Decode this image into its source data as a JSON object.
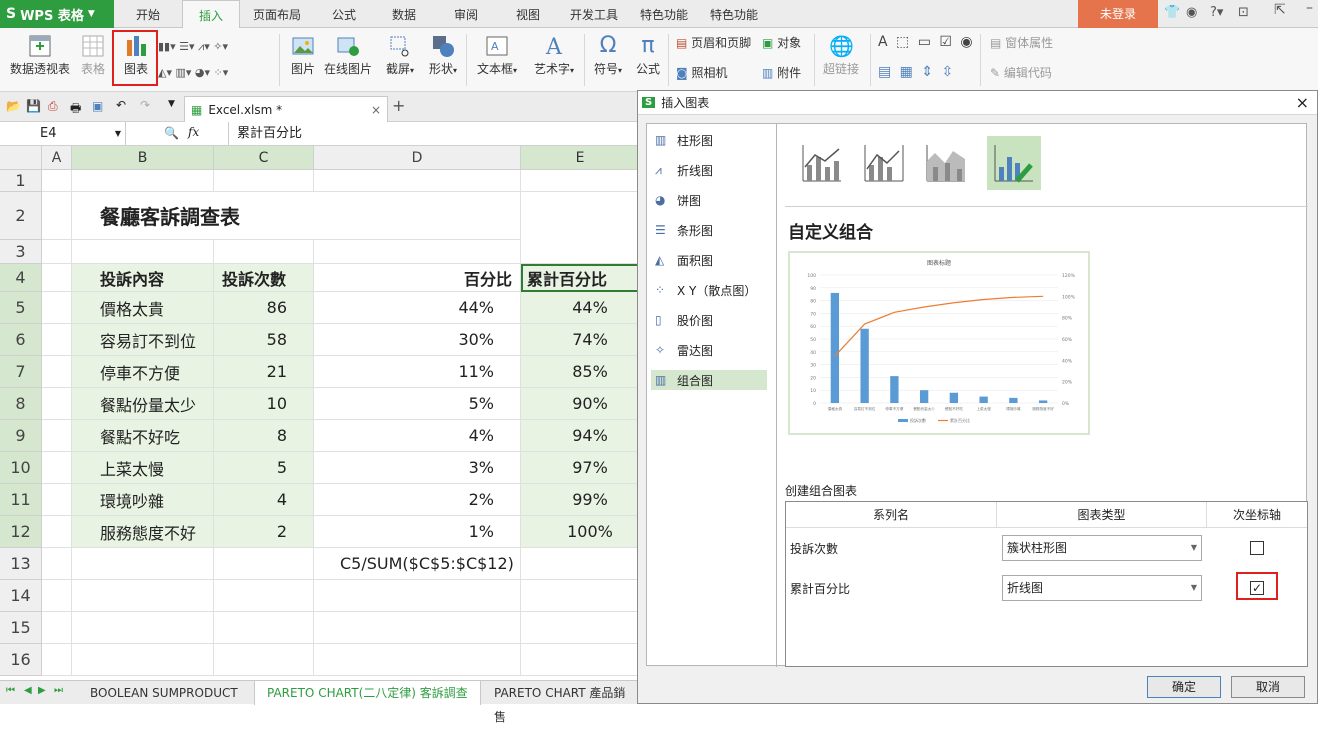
{
  "app": {
    "title": "WPS 表格",
    "login": "未登录"
  },
  "tabs": [
    "开始",
    "插入",
    "页面布局",
    "公式",
    "数据",
    "审阅",
    "视图",
    "开发工具",
    "特色功能",
    "特色功能"
  ],
  "active_tab": "插入",
  "ribbon": {
    "pivot": "数据透视表",
    "table": "表格",
    "chart": "图表",
    "picture": "图片",
    "online_picture": "在线图片",
    "screenshot": "截屏",
    "shape": "形状",
    "textbox": "文本框",
    "wordart": "艺术字",
    "symbol": "符号",
    "formula": "公式",
    "header_footer": "页眉和页脚",
    "object": "对象",
    "camera": "照相机",
    "attachment": "附件",
    "hyperlink": "超链接",
    "form_props": "窗体属性",
    "edit_code": "编辑代码"
  },
  "doc": {
    "tab": "Excel.xlsm *"
  },
  "formula_bar": {
    "cell_ref": "E4",
    "fx": "fx",
    "value": "累計百分比"
  },
  "grid": {
    "columns": [
      "A",
      "B",
      "C",
      "D",
      "E"
    ],
    "rows": [
      "1",
      "2",
      "3",
      "4",
      "5",
      "6",
      "7",
      "8",
      "9",
      "10",
      "11",
      "12",
      "13",
      "14",
      "15",
      "16"
    ],
    "title": "餐廳客訴調查表",
    "headers": [
      "投訴內容",
      "投訴次數",
      "百分比",
      "累計百分比"
    ],
    "data": [
      [
        "價格太貴",
        "86",
        "44%",
        "44%"
      ],
      [
        "容易訂不到位",
        "58",
        "30%",
        "74%"
      ],
      [
        "停車不方便",
        "21",
        "11%",
        "85%"
      ],
      [
        "餐點份量太少",
        "10",
        "5%",
        "90%"
      ],
      [
        "餐點不好吃",
        "8",
        "4%",
        "94%"
      ],
      [
        "上菜太慢",
        "5",
        "3%",
        "97%"
      ],
      [
        "環境吵雜",
        "4",
        "2%",
        "99%"
      ],
      [
        "服務態度不好",
        "2",
        "1%",
        "100%"
      ]
    ],
    "formula_note": "C5/SUM($C$5:$C$12)"
  },
  "sheets": [
    "BOOLEAN SUMPRODUCT",
    "PARETO CHART(二八定律) 客訴調查",
    "PARETO CHART 產品銷售"
  ],
  "dialog": {
    "title": "插入图表",
    "chart_types": [
      "柱形图",
      "折线图",
      "饼图",
      "条形图",
      "面积图",
      "X Y（散点图）",
      "股价图",
      "雷达图",
      "组合图"
    ],
    "selected_type": "组合图",
    "subtype_title": "自定义组合",
    "combo_label": "创建组合图表",
    "columns": [
      "系列名",
      "图表类型",
      "次坐标轴"
    ],
    "rows": [
      {
        "name": "投訴次數",
        "type": "簇状柱形图",
        "secondary": false
      },
      {
        "name": "累計百分比",
        "type": "折线图",
        "secondary": true
      }
    ],
    "ok": "确定",
    "cancel": "取消"
  },
  "chart_data": {
    "type": "bar",
    "title": "图表标题",
    "categories": [
      "價格太貴",
      "容易訂不到位",
      "停車不方便",
      "餐點份量太少",
      "餐點不好吃",
      "上菜太慢",
      "環境吵雜",
      "服務態度不好"
    ],
    "series": [
      {
        "name": "投訴次數",
        "type": "bar",
        "axis": "primary",
        "values": [
          86,
          58,
          21,
          10,
          8,
          5,
          4,
          2
        ]
      },
      {
        "name": "累計百分比",
        "type": "line",
        "axis": "secondary",
        "values": [
          0.44,
          0.74,
          0.85,
          0.9,
          0.94,
          0.97,
          0.99,
          1.0
        ]
      }
    ],
    "ylim": [
      0,
      100
    ],
    "y_ticks": [
      "0",
      "10",
      "20",
      "30",
      "40",
      "50",
      "60",
      "70",
      "80",
      "90",
      "100"
    ],
    "y2lim": [
      0,
      1.2
    ],
    "y2_ticks": [
      "0%",
      "20%",
      "40%",
      "60%",
      "80%",
      "100%",
      "120%"
    ],
    "colors": {
      "bar": "#5b9bd5",
      "line": "#ed7d31"
    },
    "legend": "bottom"
  }
}
